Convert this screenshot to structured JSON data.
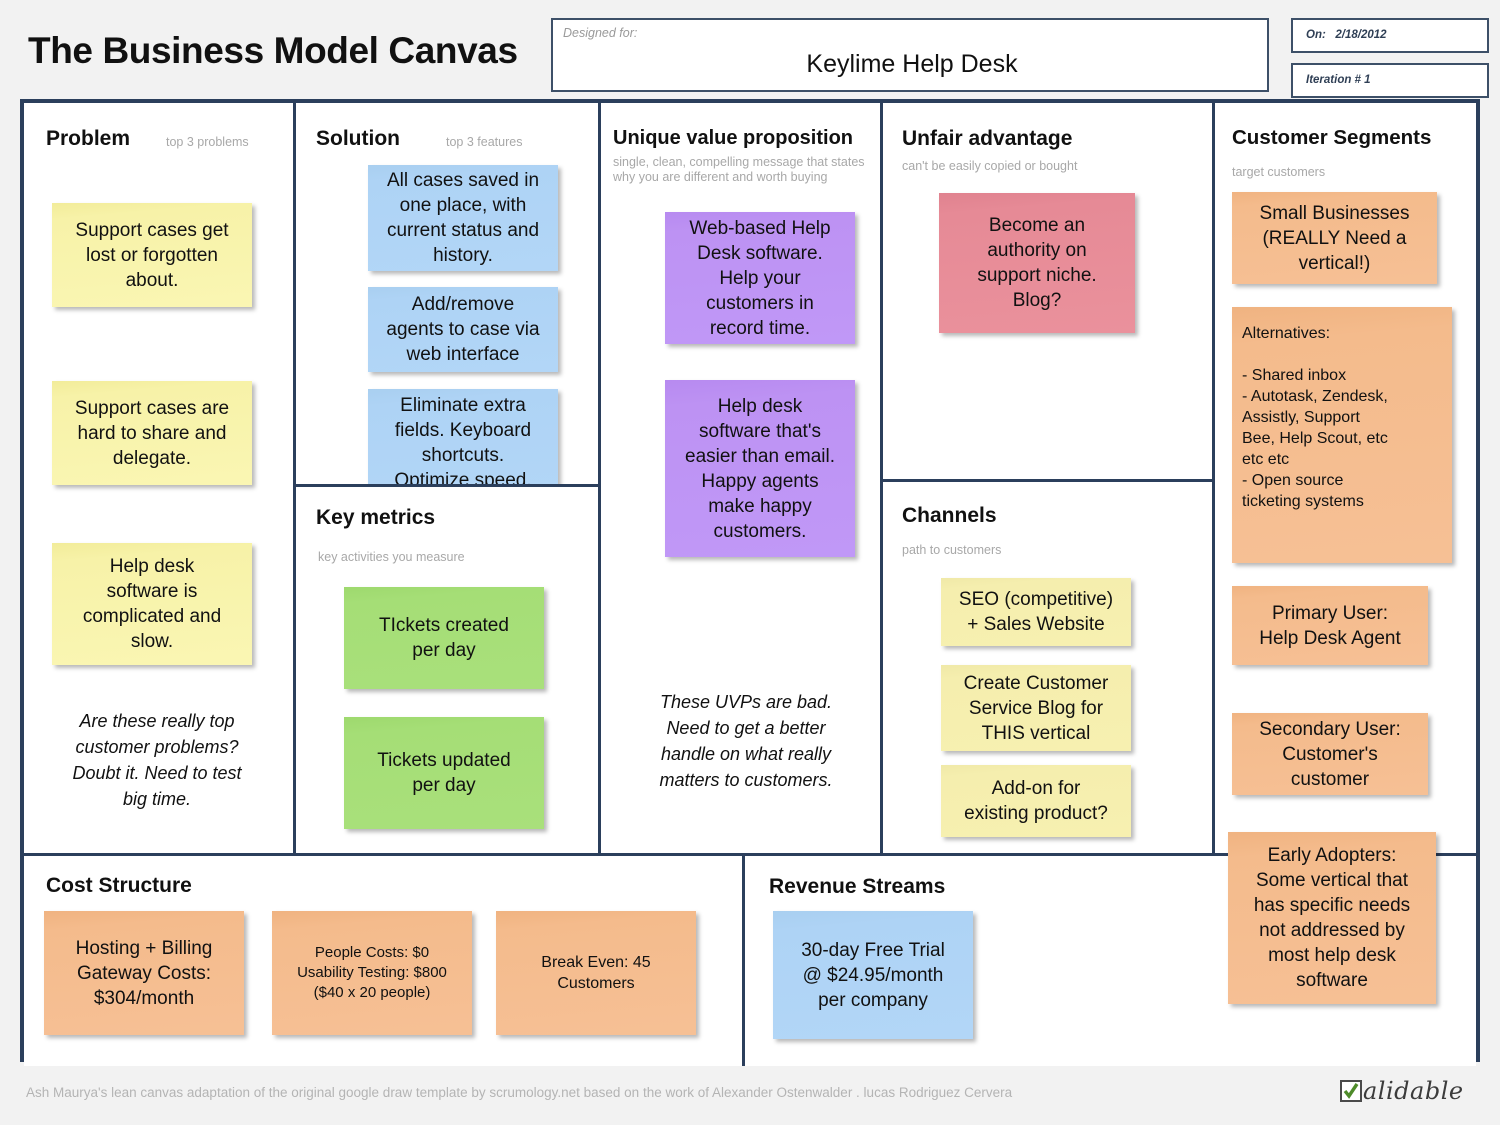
{
  "header": {
    "canvas_title": "The Business Model Canvas",
    "designed_for_label": "Designed for:",
    "designed_for_value": "Keylime Help Desk",
    "on_label": "On:",
    "on_value": "2/18/2012",
    "iteration_label": "Iteration #",
    "iteration_value": "1"
  },
  "blocks": {
    "problem": {
      "title": "Problem",
      "subtitle": "top 3 problems",
      "notes": [
        "Support cases get\nlost or forgotten\nabout.",
        "Support cases are\nhard to share and\ndelegate.",
        "Help desk\nsoftware is\ncomplicated and\nslow."
      ],
      "annotation": "Are these really top\ncustomer problems?\nDoubt it.  Need to test\nbig time."
    },
    "solution": {
      "title": "Solution",
      "subtitle": "top 3 features",
      "notes": [
        "All cases saved in\none place, with\ncurrent status and\nhistory.",
        "Add/remove\nagents to case via\nweb interface",
        "Eliminate extra\nfields. Keyboard\nshortcuts.\nOptimize speed."
      ]
    },
    "key_metrics": {
      "title": "Key metrics",
      "subtitle": "key activities you measure",
      "notes": [
        "TIckets created\nper day",
        "Tickets updated\nper day"
      ]
    },
    "uvp": {
      "title": "Unique value proposition",
      "subtitle": "single, clean, compelling message that states why you are different and worth buying",
      "notes": [
        "Web-based Help\nDesk software.\nHelp your\ncustomers in\nrecord time.",
        "Help desk\nsoftware that's\neasier than email.\nHappy agents\nmake happy\ncustomers."
      ],
      "annotation": "These UVPs are bad.\nNeed to get a better\nhandle on what really\nmatters to customers."
    },
    "unfair_advantage": {
      "title": "Unfair advantage",
      "subtitle": "can't be easily copied or bought",
      "notes": [
        "Become an\nauthority on\nsupport niche.\nBlog?"
      ]
    },
    "channels": {
      "title": "Channels",
      "subtitle": "path to customers",
      "notes": [
        "SEO (competitive)\n+ Sales Website",
        "Create Customer\nService Blog for\nTHIS vertical",
        "Add-on for\nexisting product?"
      ]
    },
    "customer_segments": {
      "title": "Customer Segments",
      "subtitle": "target customers",
      "notes": [
        "Small Businesses\n(REALLY Need a\nvertical!)",
        "Alternatives:\n\n- Shared inbox\n- Autotask, Zendesk,\nAssistly, Support\nBee, Help Scout, etc\netc etc\n- Open source\nticketing systems",
        "Primary User:\nHelp Desk Agent",
        "Secondary User:\nCustomer's\ncustomer",
        "Early Adopters:\nSome vertical that\nhas specific needs\nnot addressed by\nmost help desk\nsoftware"
      ]
    },
    "cost_structure": {
      "title": "Cost Structure",
      "notes": [
        "Hosting + Billing\nGateway Costs:\n$304/month",
        "People Costs:  $0\nUsability Testing: $800\n($40 x 20 people)",
        "Break Even:  45\nCustomers"
      ]
    },
    "revenue_streams": {
      "title": "Revenue Streams",
      "notes": [
        "30-day Free Trial\n@ $24.95/month\nper company"
      ]
    }
  },
  "footer": {
    "credit": "Ash Maurya's lean canvas adaptation of the original google draw template by scrumology.net based on the work of Alexander Ostenwalder . lucas Rodriguez Cervera",
    "logo_check": "✔",
    "logo_word": "alidable"
  },
  "colors": {
    "frame": "#2b3f5c",
    "note_yellow": "#f7f0b0",
    "note_blue": "#b2d6f7",
    "note_green": "#a9e07b",
    "note_purple": "#c098f7",
    "note_pink": "#ea919c",
    "note_orange": "#f6c095",
    "subtitle_gray": "#a8a8a8"
  }
}
